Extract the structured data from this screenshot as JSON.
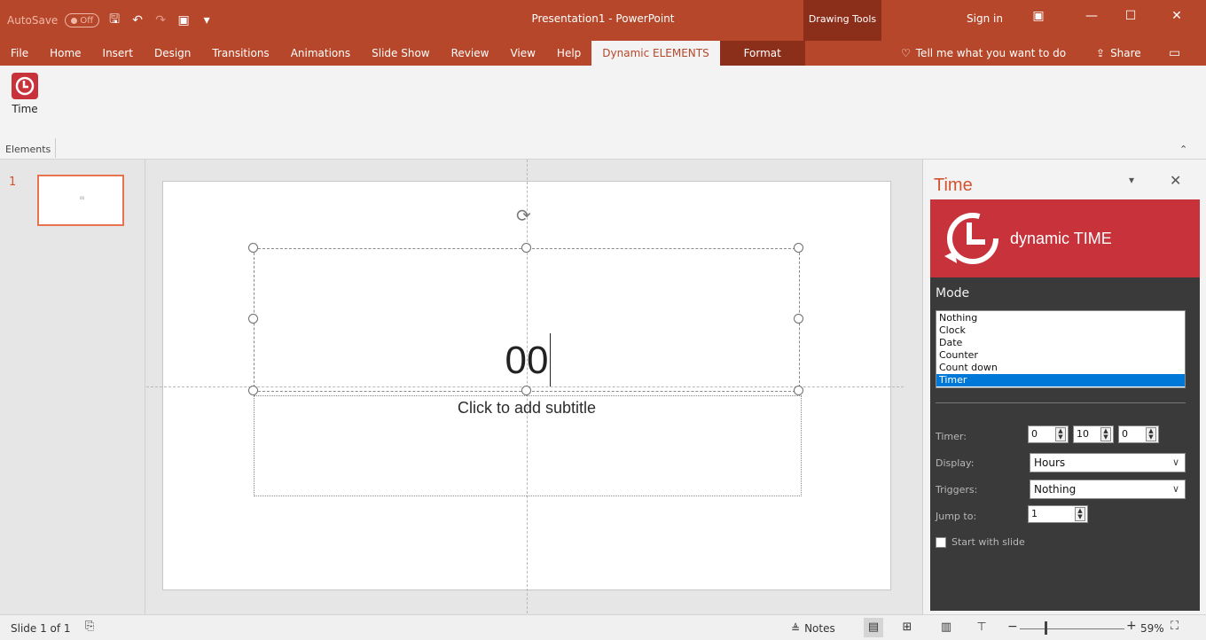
{
  "titlebar": {
    "autosave_label": "AutoSave",
    "autosave_state": "Off",
    "title": "Presentation1  -  PowerPoint",
    "context_label": "Drawing Tools",
    "sign_in": "Sign in"
  },
  "tabs": [
    "File",
    "Home",
    "Insert",
    "Design",
    "Transitions",
    "Animations",
    "Slide Show",
    "Review",
    "View",
    "Help",
    "Dynamic ELEMENTS",
    "Format"
  ],
  "active_tab": "Dynamic ELEMENTS",
  "tell_me": "Tell me what you want to do",
  "share": "Share",
  "ribbon": {
    "time_button": "Time",
    "group_label": "Elements",
    "collapse_icon": "chevron-up-icon"
  },
  "thumbnails": [
    {
      "number": "1"
    }
  ],
  "slide": {
    "title_text": "00",
    "subtitle_placeholder": "Click to add subtitle"
  },
  "pane": {
    "title": "Time",
    "banner_text": "dynamic TIME",
    "mode_label": "Mode",
    "mode_options": [
      "Nothing",
      "Clock",
      "Date",
      "Counter",
      "Count down",
      "Timer"
    ],
    "mode_selected": "Timer",
    "timer_label": "Timer:",
    "timer_values": [
      "0",
      "10",
      "0"
    ],
    "display_label": "Display:",
    "display_value": "Hours",
    "triggers_label": "Triggers:",
    "triggers_value": "Nothing",
    "jump_label": "Jump to:",
    "jump_value": "1",
    "start_label": "Start with slide",
    "start_checked": false
  },
  "status": {
    "slide_count": "Slide 1 of 1",
    "notes": "Notes",
    "zoom_level": "59%"
  },
  "colors": {
    "title_bar": "#b7472a",
    "context_tab": "#8c2f1a",
    "banner": "#c8323a",
    "selection": "#0078d7"
  }
}
